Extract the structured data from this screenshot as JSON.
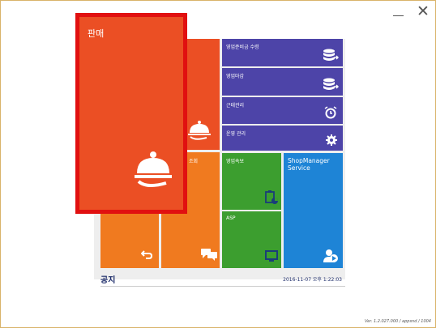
{
  "window": {
    "minimize": "minimize",
    "close": "close"
  },
  "tiles": {
    "sales": {
      "label": "판매"
    },
    "sales_back": {
      "label": ""
    },
    "lookup": {
      "label": "조회"
    },
    "sales_income": {
      "label": "영업준비금 수령"
    },
    "sales_settle": {
      "label": "영업마감"
    },
    "attendance": {
      "label": "근태관리"
    },
    "operation": {
      "label": "운영 관리"
    },
    "sales_report": {
      "label": "영업속보"
    },
    "asp": {
      "label": "ASP"
    },
    "shopmanager": {
      "label": "ShopManager\nService"
    }
  },
  "notice": {
    "title": "공지",
    "timestamp": "2016-11-07 오후 1:22:03"
  },
  "version": "Ver. 1.2.027.000 / appsnd / 1004",
  "colors": {
    "orange_red": "#eb4f24",
    "orange": "#f07a1f",
    "purple": "#4d44a8",
    "green": "#3c9e2f",
    "blue": "#1e84d6",
    "highlight_border": "#e11010"
  }
}
